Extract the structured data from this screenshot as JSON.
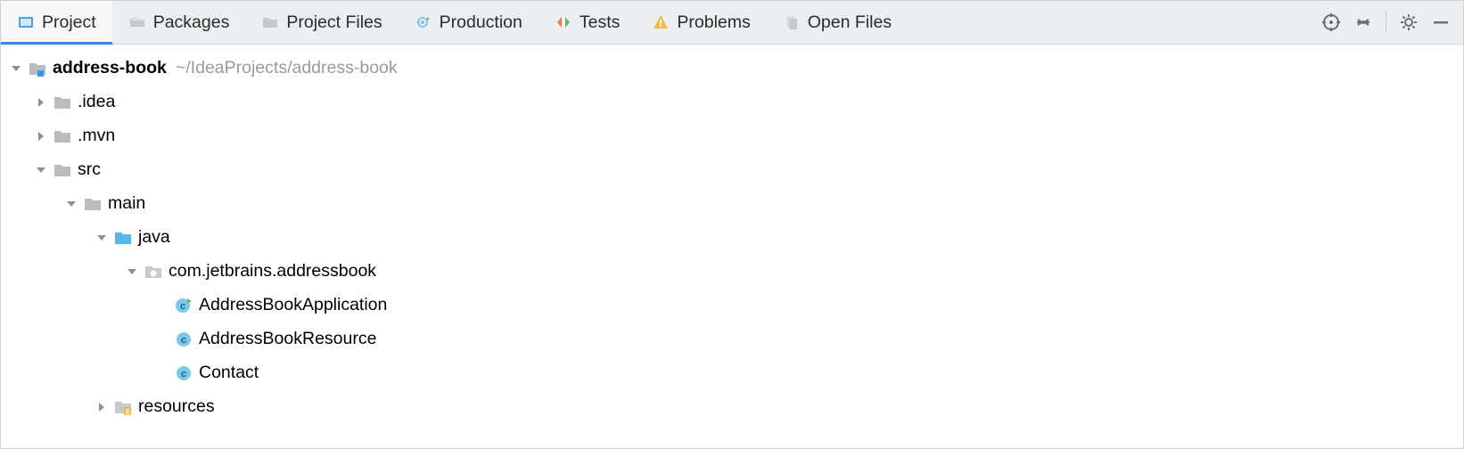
{
  "tabs": {
    "project": "Project",
    "packages": "Packages",
    "projectFiles": "Project Files",
    "production": "Production",
    "tests": "Tests",
    "problems": "Problems",
    "openFiles": "Open Files"
  },
  "tree": {
    "root": {
      "name": "address-book",
      "path": "~/IdeaProjects/address-book"
    },
    "idea": ".idea",
    "mvn": ".mvn",
    "src": "src",
    "main": "main",
    "java": "java",
    "pkg": "com.jetbrains.addressbook",
    "cls1": "AddressBookApplication",
    "cls2": "AddressBookResource",
    "cls3": "Contact",
    "resources": "resources"
  }
}
